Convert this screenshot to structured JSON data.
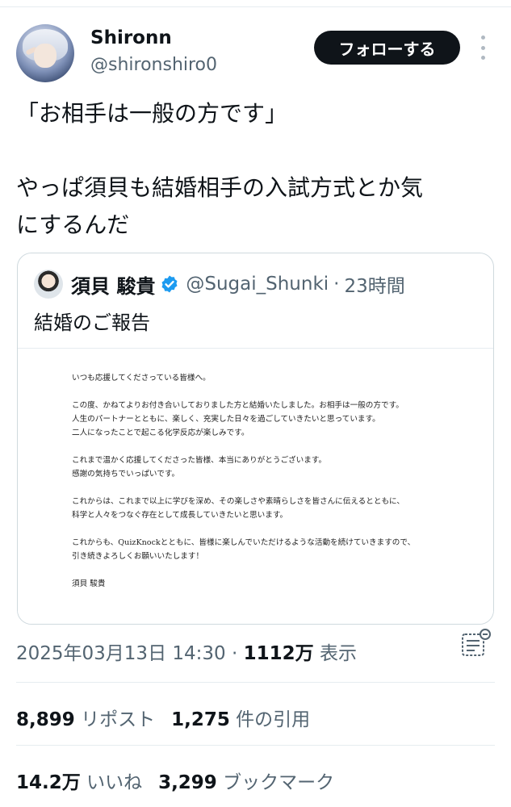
{
  "author": {
    "display_name": "Shironn",
    "handle": "@shironshiro0"
  },
  "follow_label": "フォローする",
  "tweet": {
    "lines": [
      "「お相手は一般の方です」",
      "やっぱ須貝も結婚相手の入試方式とか気",
      "にするんだ"
    ]
  },
  "quote": {
    "name": "須貝 駿貴",
    "handle": "@Sugai_Shunki",
    "separator": "·",
    "time": "23時間",
    "text": "結婚のご報告",
    "document": {
      "lines": [
        "いつも応援してくださっている皆様へ。",
        "",
        "この度、かねてよりお付き合いしておりました方と結婚いたしました。お相手は一般の方です。",
        "人生のパートナーとともに、楽しく、充実した日々を過ごしていきたいと思っています。",
        "二人になったことで起こる化学反応が楽しみです。",
        "",
        "これまで温かく応援してくださった皆様、本当にありがとうございます。",
        "感謝の気持ちでいっぱいです。",
        "",
        "これからは、これまで以上に学びを深め、その楽しさや素晴らしさを皆さんに伝えるとともに、",
        "科学と人々をつなぐ存在として成長していきたいと思います。",
        "",
        "これからも、QuizKnockとともに、皆様に楽しんでいただけるような活動を続けていきますので、",
        "引き続きよろしくお願いいたします！",
        "",
        "須貝 駿貴"
      ]
    }
  },
  "meta": {
    "timestamp": "2025年03月13日 14:30",
    "separator": "·",
    "views_count": "1112万",
    "views_label": "表示"
  },
  "stats": {
    "reposts_count": "8,899",
    "reposts_label": "リポスト",
    "quotes_count": "1,275",
    "quotes_label": "件の引用",
    "likes_count": "14.2万",
    "likes_label": "いいね",
    "bookmarks_count": "3,299",
    "bookmarks_label": "ブックマーク"
  },
  "colors": {
    "text": "#0f1419",
    "secondary": "#536471",
    "verified": "#1d9bf0",
    "border": "#cfd9de"
  }
}
